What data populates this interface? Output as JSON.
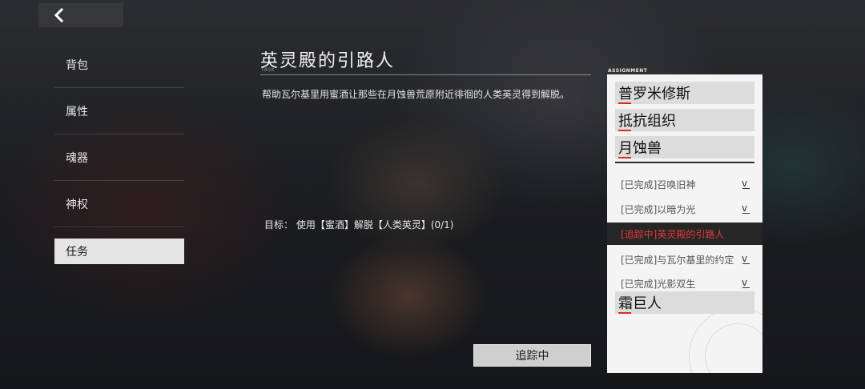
{
  "nav": {
    "back_icon": "chevron-left-icon"
  },
  "sidebar": {
    "items": [
      {
        "label": "背包"
      },
      {
        "label": "属性"
      },
      {
        "label": "魂器"
      },
      {
        "label": "神权"
      },
      {
        "label": "任务"
      }
    ]
  },
  "task": {
    "title": "英灵殿的引路人",
    "subtitle": "TASK",
    "description": "帮助瓦尔基里用蜜酒让那些在月蚀兽荒原附近徘徊的人类英灵得到解脱。",
    "objective": "目标：  使用【蜜酒】解脱【人类英灵】(0/1)",
    "track_button": "追踪中"
  },
  "assignment": {
    "header": "ASSIGNMENT",
    "groups_top": [
      "普罗米修斯",
      "抵抗组织",
      "月蚀兽"
    ],
    "quests": [
      {
        "label": "[已完成]召唤旧神",
        "current": false
      },
      {
        "label": "[已完成]以暗为光",
        "current": false
      },
      {
        "label": "[追踪中]英灵殿的引路人",
        "current": true
      },
      {
        "label": "[已完成]与瓦尔基里的约定",
        "current": false
      },
      {
        "label": "[已完成]光影双生",
        "current": false
      }
    ],
    "group_bottom": "霜巨人",
    "accent_color": "#e0252b"
  }
}
